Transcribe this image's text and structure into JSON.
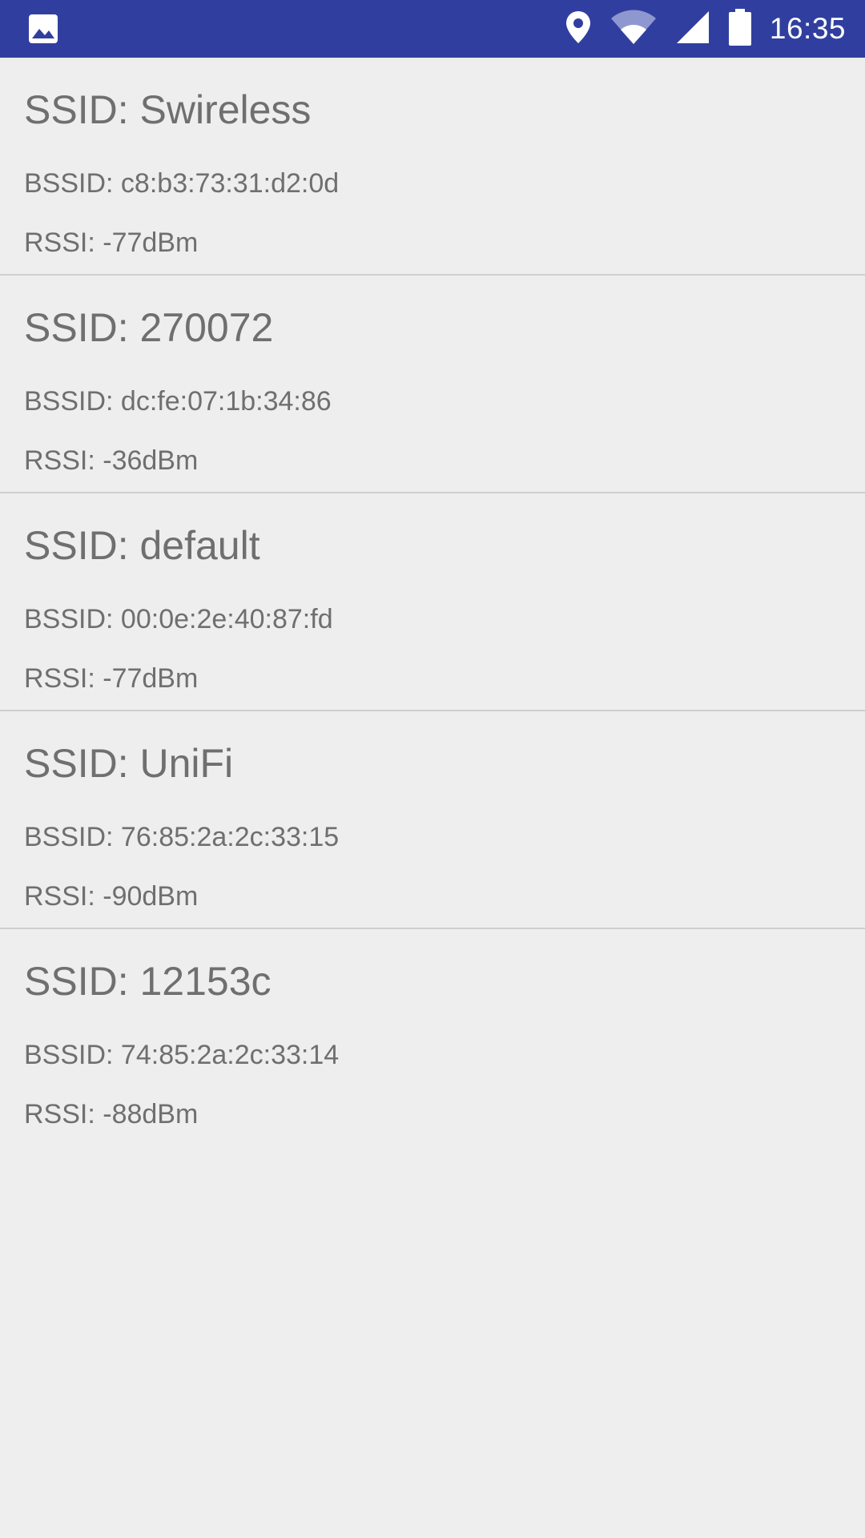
{
  "status_bar": {
    "time": "16:35",
    "left_icon": "image-icon",
    "icons": [
      "location-pin-icon",
      "wifi-icon",
      "cell-signal-icon",
      "battery-icon"
    ],
    "background": "#303f9f"
  },
  "networks": [
    {
      "ssid": "SSID: Swireless",
      "bssid": "BSSID: c8:b3:73:31:d2:0d",
      "rssi": "RSSI: -77dBm"
    },
    {
      "ssid": "SSID: 270072",
      "bssid": "BSSID: dc:fe:07:1b:34:86",
      "rssi": "RSSI: -36dBm"
    },
    {
      "ssid": "SSID: default",
      "bssid": "BSSID: 00:0e:2e:40:87:fd",
      "rssi": "RSSI: -77dBm"
    },
    {
      "ssid": "SSID: UniFi",
      "bssid": "BSSID: 76:85:2a:2c:33:15",
      "rssi": "RSSI: -90dBm"
    },
    {
      "ssid": "SSID: 12153c",
      "bssid": "BSSID: 74:85:2a:2c:33:14",
      "rssi": "RSSI: -88dBm"
    }
  ]
}
